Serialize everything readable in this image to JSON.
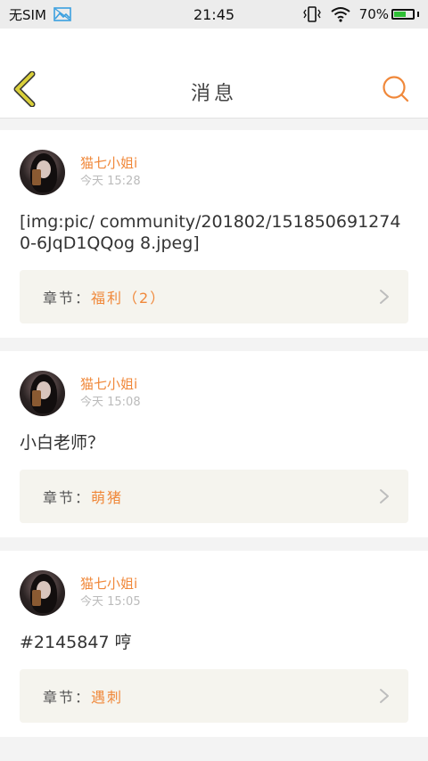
{
  "status_bar": {
    "carrier": "无SIM",
    "time": "21:45",
    "battery": "70%",
    "battery_level": 0.7
  },
  "header": {
    "title": "消息",
    "back_icon": "back-chevron-icon",
    "search_icon": "search-icon"
  },
  "colors": {
    "accent": "#f0883a",
    "back_icon": "#d9cf3a",
    "chapter_bg": "#f5f4ee"
  },
  "messages": [
    {
      "username": "猫七小姐i",
      "time": "今天 15:28",
      "content": "[img:pic/ community/201802/1518506912740-6JqD1QQog 8.jpeg]",
      "chapter_label": "章节：",
      "chapter_name": "福利（2）"
    },
    {
      "username": "猫七小姐i",
      "time": "今天 15:08",
      "content": "小白老师？",
      "chapter_label": "章节：",
      "chapter_name": "萌猪"
    },
    {
      "username": "猫七小姐i",
      "time": "今天 15:05",
      "content": "#2145847 哼",
      "chapter_label": "章节：",
      "chapter_name": "遇刺"
    }
  ]
}
